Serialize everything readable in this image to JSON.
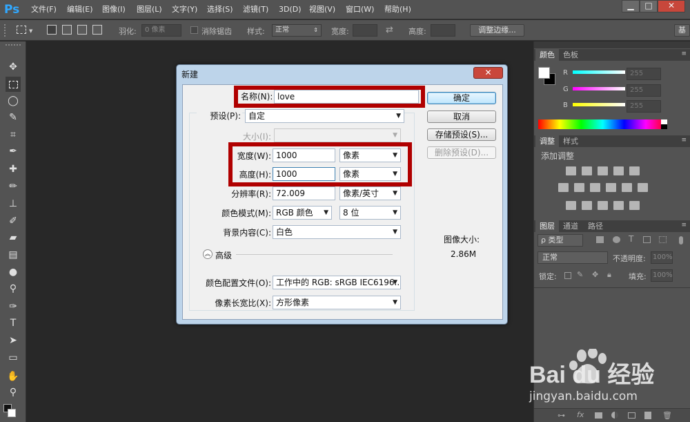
{
  "app": {
    "logo": "Ps"
  },
  "menu": [
    "文件(F)",
    "编辑(E)",
    "图像(I)",
    "图层(L)",
    "文字(Y)",
    "选择(S)",
    "滤镜(T)",
    "3D(D)",
    "视图(V)",
    "窗口(W)",
    "帮助(H)"
  ],
  "window_controls": {
    "minimize": "▁",
    "maximize": "□",
    "close": "✕"
  },
  "options": {
    "feather_label": "羽化:",
    "feather_value": "0 像素",
    "antialias_label": "消除锯齿",
    "style_label": "样式:",
    "style_value": "正常",
    "width_label": "宽度:",
    "height_label": "高度:",
    "refine_edge": "调整边缘...",
    "workspace": "基"
  },
  "color_panel": {
    "tabs": [
      "颜色",
      "色板"
    ],
    "channels": [
      {
        "label": "R",
        "value": "255",
        "color": "#ff0000"
      },
      {
        "label": "G",
        "value": "255",
        "color": "#00ff00"
      },
      {
        "label": "B",
        "value": "255",
        "color": "#0000ff"
      }
    ]
  },
  "adjust_panel": {
    "tabs": [
      "调整",
      "样式"
    ],
    "title": "添加调整"
  },
  "layers_panel": {
    "tabs": [
      "图层",
      "通道",
      "路径"
    ],
    "kind": "ρ 类型",
    "blend": "正常",
    "opacity_label": "不透明度:",
    "opacity_value": "100%",
    "lock_label": "锁定:",
    "fill_label": "填充:",
    "fill_value": "100%"
  },
  "dialog": {
    "title": "新建",
    "close": "✕",
    "name_label": "名称(N):",
    "name_value": "love",
    "preset_label": "预设(P):",
    "preset_value": "自定",
    "size_label": "大小(I):",
    "width_label": "宽度(W):",
    "width_value": "1000",
    "width_unit": "像素",
    "height_label": "高度(H):",
    "height_value": "1000",
    "height_unit": "像素",
    "resolution_label": "分辨率(R):",
    "resolution_value": "72.009",
    "resolution_unit": "像素/英寸",
    "color_mode_label": "颜色模式(M):",
    "color_mode_value": "RGB 颜色",
    "bit_depth_value": "8 位",
    "background_label": "背景内容(C):",
    "background_value": "白色",
    "advanced_label": "高级",
    "color_profile_label": "颜色配置文件(O):",
    "color_profile_value": "工作中的 RGB: sRGB IEC6196...",
    "pixel_aspect_label": "像素长宽比(X):",
    "pixel_aspect_value": "方形像素",
    "ok_button": "确定",
    "cancel_button": "取消",
    "save_preset_button": "存储预设(S)...",
    "delete_preset_button": "删除预设(D)...",
    "image_size_label": "图像大小:",
    "image_size_value": "2.86M"
  },
  "watermark": {
    "brand": "Bai du 经验",
    "url": "jingyan.baidu.com"
  }
}
